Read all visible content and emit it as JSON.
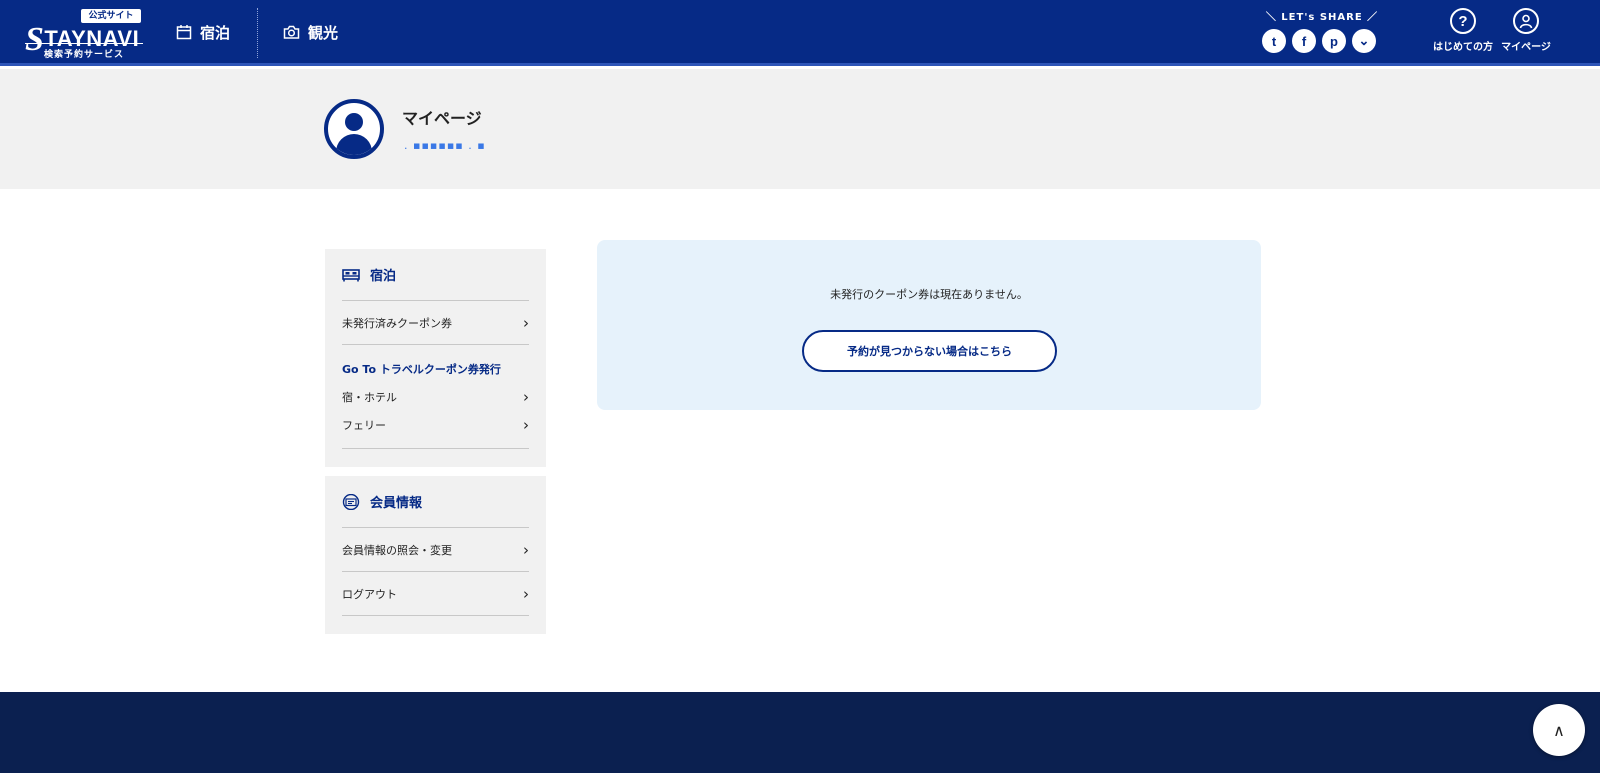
{
  "header": {
    "logo": {
      "badge": "公式サイト",
      "s_letter": "S",
      "main_text": "TAYNAVI",
      "sub": "検索予約サービス"
    },
    "nav": [
      {
        "label": "宿泊",
        "icon": "calendar-icon"
      },
      {
        "label": "観光",
        "icon": "camera-icon"
      }
    ],
    "share": {
      "label": "＼ LET's SHARE ／",
      "buttons": [
        {
          "name": "twitter",
          "glyph": "t"
        },
        {
          "name": "facebook",
          "glyph": "f"
        },
        {
          "name": "pinterest",
          "glyph": "p"
        },
        {
          "name": "pocket",
          "glyph": "⌄"
        }
      ]
    },
    "first_time": {
      "label": "はじめての方",
      "glyph": "?"
    },
    "mypage": {
      "label": "マイページ"
    }
  },
  "profile": {
    "title": "マイページ",
    "username": ". ▪▪▪▪▪▪ . ▪"
  },
  "sidebar": {
    "stay": {
      "heading": "宿泊",
      "issued_coupons": "未発行済みクーポン券",
      "goto_heading": "Go To トラベルクーポン券発行",
      "hotel": "宿・ホテル",
      "ferry": "フェリー"
    },
    "member": {
      "heading": "会員情報",
      "view_edit": "会員情報の照会・変更",
      "logout": "ログアウト"
    },
    "chevron": "›"
  },
  "main": {
    "message": "未発行のクーポン券は現在ありません。",
    "button": "予約が見つからない場合はこちら"
  },
  "to_top": "∧",
  "colors": {
    "primary": "#062a86",
    "footer": "#0b2050",
    "panel": "#e6f2fb",
    "banner": "#f1f1f1"
  }
}
